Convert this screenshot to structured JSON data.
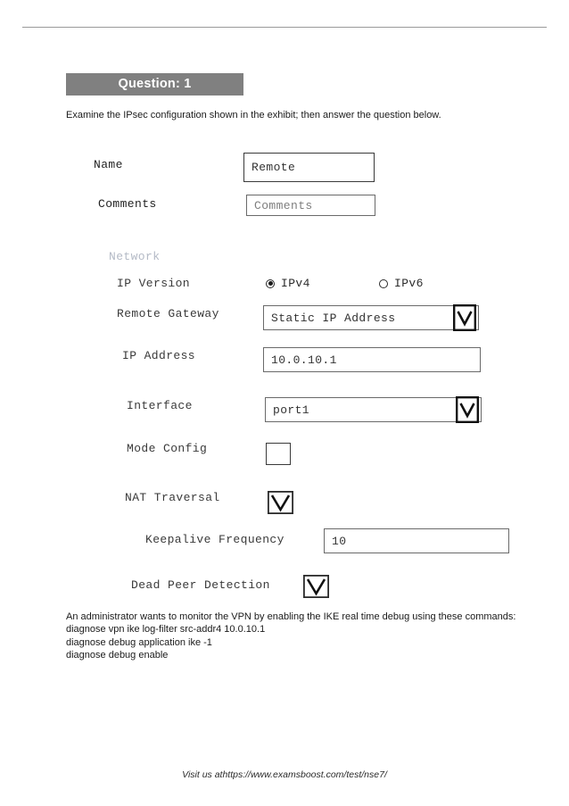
{
  "document": {
    "question_banner": "Question: 1",
    "intro": "Examine the IPsec configuration shown in the exhibit; then answer the question below.",
    "footer": "Visit us athttps://www.examsboost.com/test/nse7/"
  },
  "exhibit": {
    "name": {
      "label": "Name",
      "value": "Remote"
    },
    "comments": {
      "label": "Comments",
      "value": "Comments"
    },
    "network_section": {
      "title": "Network",
      "ip_version": {
        "label": "IP Version",
        "options": [
          "IPv4",
          "IPv6"
        ],
        "selected": "IPv4"
      },
      "remote_gateway": {
        "label": "Remote Gateway",
        "value": "Static IP Address"
      },
      "ip_address": {
        "label": "IP Address",
        "value": "10.0.10.1"
      },
      "interface": {
        "label": "Interface",
        "value": "port1"
      },
      "mode_config": {
        "label": "Mode Config",
        "checked": false
      },
      "nat_traversal": {
        "label": "NAT Traversal",
        "checked": true
      },
      "keepalive_frequency": {
        "label": "Keepalive Frequency",
        "value": "10"
      },
      "dead_peer_detection": {
        "label": "Dead Peer Detection",
        "checked": true
      }
    }
  },
  "question_body": {
    "line1": "An administrator wants to monitor the VPN by enabling the IKE real time debug using these commands:",
    "line2": "diagnose vpn ike log-filter src-addr4 10.0.10.1",
    "line3": "diagnose debug application ike -1",
    "line4": "diagnose debug enable"
  },
  "colors": {
    "banner_bg": "#808080",
    "banner_text": "#ffffff",
    "section_title": "#b4bac6",
    "rule": "#9a9a9a"
  }
}
